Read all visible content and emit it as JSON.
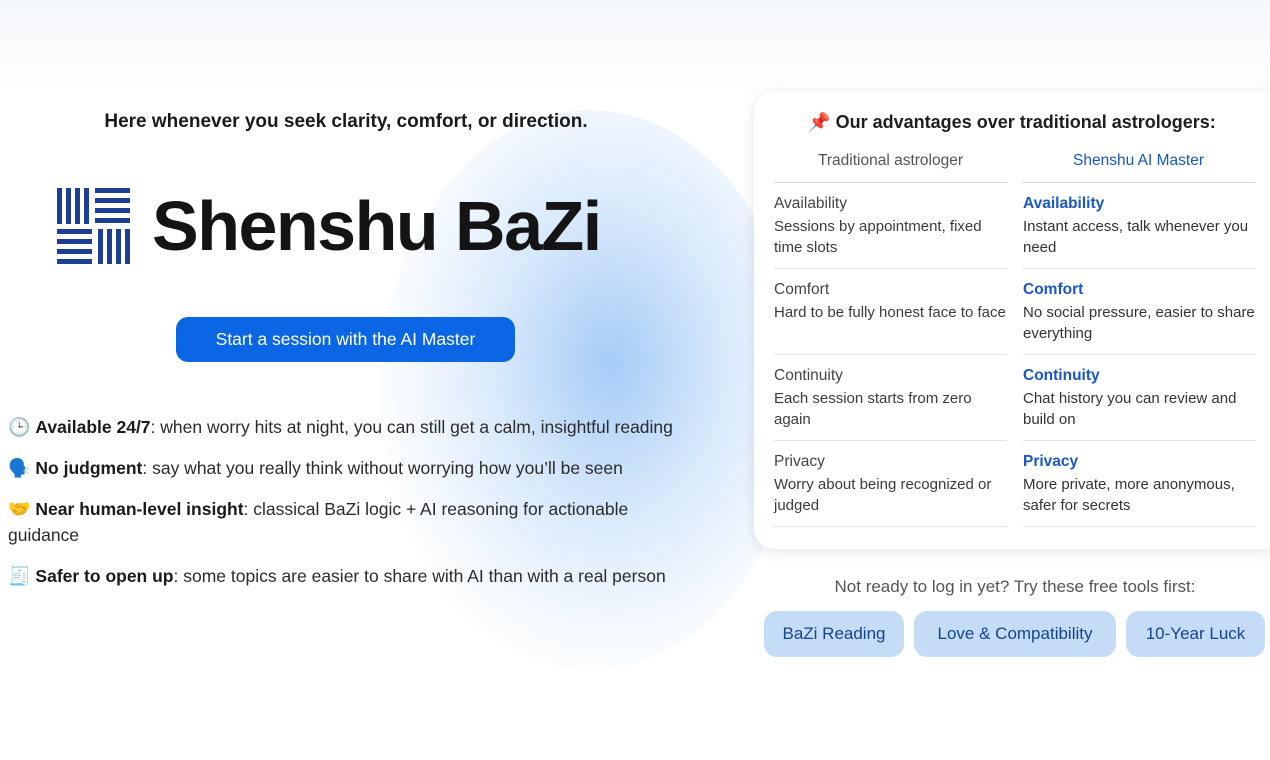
{
  "hero": {
    "tagline": "Here whenever you seek clarity, comfort, or direction.",
    "brand_name": "Shenshu BaZi",
    "cta_label": "Start a session with the AI Master"
  },
  "features": [
    {
      "emoji": "🕒",
      "icon": "clock-icon",
      "title": "Available 24/7",
      "text": ": when worry hits at night, you can still get a calm, insightful reading"
    },
    {
      "emoji": "🗣️",
      "icon": "speaking-head-icon",
      "title": "No judgment",
      "text": ": say what you really think without worrying how you’ll be seen"
    },
    {
      "emoji": "🤝",
      "icon": "handshake-icon",
      "title": "Near human-level insight",
      "text": ": classical BaZi logic + AI reasoning for actionable guidance"
    },
    {
      "emoji": "🧾",
      "icon": "receipt-icon",
      "title": "Safer to open up",
      "text": ": some topics are easier to share with AI than with a real person"
    }
  ],
  "comparison": {
    "title_icon": "📌",
    "title": "Our advantages over traditional astrologers:",
    "col_traditional": "Traditional astrologer",
    "col_ai": "Shenshu AI Master",
    "rows": [
      {
        "trad_label": "Availability",
        "trad_desc": "Sessions by appointment, fixed time slots",
        "ai_label": "Availability",
        "ai_desc": "Instant access, talk whenever you need"
      },
      {
        "trad_label": "Comfort",
        "trad_desc": "Hard to be fully honest face to face",
        "ai_label": "Comfort",
        "ai_desc": "No social pressure, easier to share everything"
      },
      {
        "trad_label": "Continuity",
        "trad_desc": "Each session starts from zero again",
        "ai_label": "Continuity",
        "ai_desc": "Chat history you can review and build on"
      },
      {
        "trad_label": "Privacy",
        "trad_desc": "Worry about being recognized or judged",
        "ai_label": "Privacy",
        "ai_desc": "More private, more anonymous, safer for secrets"
      }
    ]
  },
  "tools": {
    "caption": "Not ready to log in yet? Try these free tools first:",
    "items": [
      "BaZi Reading",
      "Love & Compatibility",
      "10-Year Luck"
    ]
  },
  "colors": {
    "accent": "#0a66e4",
    "ai_text": "#1a56c4",
    "tool_bg": "#c4dcf6",
    "brand_mark": "#1c3f94"
  }
}
